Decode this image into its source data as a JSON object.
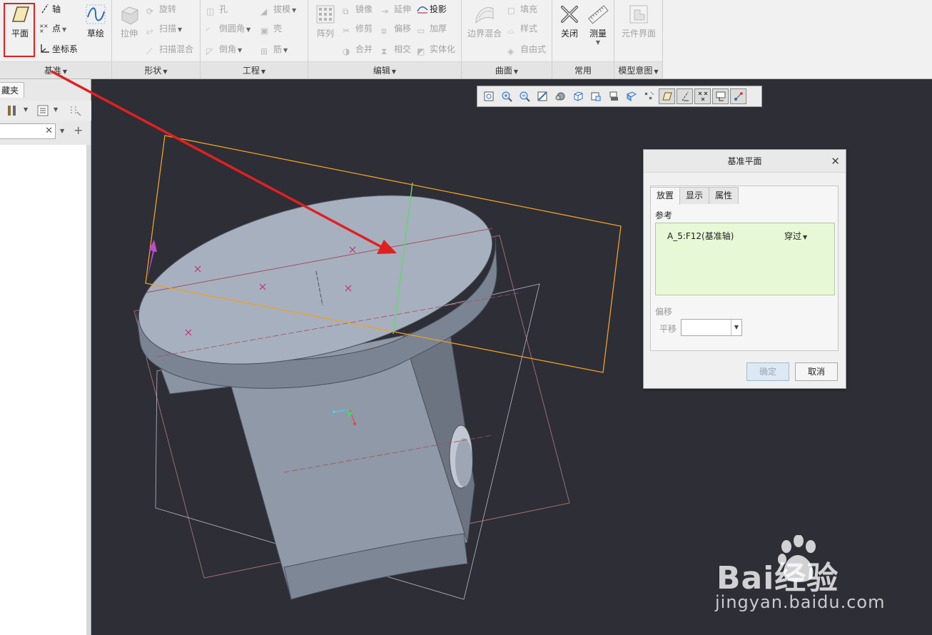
{
  "ribbon": {
    "groups": {
      "datum": {
        "label": "基准",
        "plane": "平面",
        "axis": "轴",
        "point": "点",
        "csys": "坐标系",
        "sketch": "草绘"
      },
      "shapes": {
        "label": "形状",
        "extrude": "拉伸",
        "revolve": "旋转",
        "sweep": "扫描",
        "swept_blend": "扫描混合"
      },
      "engineering": {
        "label": "工程",
        "hole": "孔",
        "round": "倒圆角",
        "chamfer": "倒角",
        "draft": "拔模",
        "shell": "壳",
        "rib": "筋"
      },
      "editing": {
        "label": "编辑",
        "pattern": "阵列",
        "mirror": "镜像",
        "trim": "修剪",
        "merge": "合并",
        "extend": "延伸",
        "offset": "偏移",
        "intersect": "相交",
        "project": "投影",
        "thicken": "加厚",
        "solidify": "实体化"
      },
      "surfaces": {
        "label": "曲面",
        "boundary_blend": "边界混合",
        "fill": "填充",
        "style": "样式",
        "freestyle": "自由式"
      },
      "common": {
        "label": "常用",
        "close": "关闭",
        "measure": "测量"
      },
      "model_intent": {
        "label": "模型意图",
        "component_interface": "元件界面"
      }
    }
  },
  "left_panel": {
    "tab_label": "藏夹",
    "search_value": ""
  },
  "dialog": {
    "title": "基准平面",
    "tabs": [
      "放置",
      "显示",
      "属性"
    ],
    "active_tab": "放置",
    "references_label": "参考",
    "reference_item": "A_5:F12(基准轴)",
    "reference_type": "穿过",
    "offset_label": "偏移",
    "translate_label": "平移",
    "translate_value": "",
    "ok_label": "确定",
    "cancel_label": "取消"
  },
  "watermark": {
    "brand": "Bai经验",
    "url": "jingyan.baidu.com"
  },
  "colors": {
    "ribbon_bg": "#f1f1f1",
    "viewport_bg": "#2d2e36",
    "model_surface": "#9aa3b0",
    "datum_plane_yellow": "#f0a020",
    "annotation_arrow": "#e02020",
    "reference_box": "#e7f8d6"
  }
}
